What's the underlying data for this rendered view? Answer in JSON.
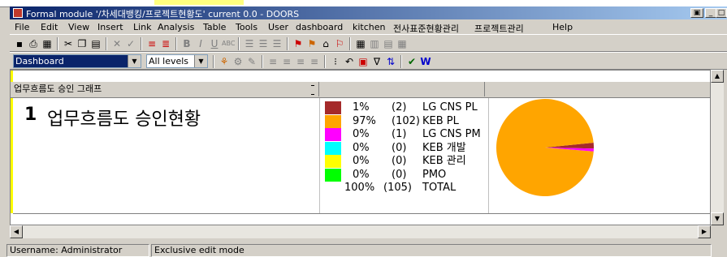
{
  "window": {
    "title": "Formal module '/차세대뱅킹/프로젝트현황도' current 0.0 - DOORS"
  },
  "menu": [
    "File",
    "Edit",
    "View",
    "Insert",
    "Link",
    "Analysis",
    "Table",
    "Tools",
    "User",
    "dashboard",
    "kitchen",
    "전사표준현황관리",
    "프로젝트관리",
    "Help"
  ],
  "toolbar": {
    "view_select": "Dashboard",
    "level_select": "All levels"
  },
  "table": {
    "column_header": "업무흐름도 승인 그래프",
    "row": {
      "number": "1",
      "heading": "업무흐름도 승인현황"
    }
  },
  "chart_data": {
    "type": "pie",
    "categories": [
      "LG CNS PL",
      "KEB PL",
      "LG CNS PM",
      "KEB 개발",
      "KEB 관리",
      "PMO"
    ],
    "values": [
      2,
      102,
      1,
      0,
      0,
      0
    ],
    "percents": [
      "1%",
      "97%",
      "0%",
      "0%",
      "0%",
      "0%"
    ],
    "counts": [
      "(2)",
      "(102)",
      "(1)",
      "(0)",
      "(0)",
      "(0)"
    ],
    "colors": [
      "#a52a2a",
      "#ffa500",
      "#ff00ff",
      "#00ffff",
      "#ffff00",
      "#00ff00"
    ],
    "total": {
      "percent": "100%",
      "count": "(105)",
      "label": "TOTAL"
    }
  },
  "status": {
    "user": "Username: Administrator",
    "mode": "Exclusive edit mode"
  }
}
